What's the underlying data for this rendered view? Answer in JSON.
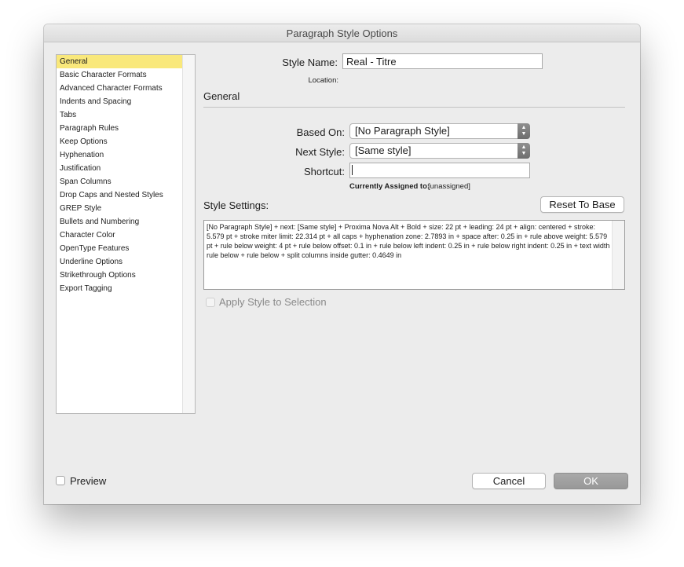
{
  "window": {
    "title": "Paragraph Style Options"
  },
  "sidebar": {
    "items": [
      {
        "label": "General",
        "selected": true
      },
      {
        "label": "Basic Character Formats"
      },
      {
        "label": "Advanced Character Formats"
      },
      {
        "label": "Indents and Spacing"
      },
      {
        "label": "Tabs"
      },
      {
        "label": "Paragraph Rules"
      },
      {
        "label": "Keep Options"
      },
      {
        "label": "Hyphenation"
      },
      {
        "label": "Justification"
      },
      {
        "label": "Span Columns"
      },
      {
        "label": "Drop Caps and Nested Styles"
      },
      {
        "label": "GREP Style"
      },
      {
        "label": "Bullets and Numbering"
      },
      {
        "label": "Character Color"
      },
      {
        "label": "OpenType Features"
      },
      {
        "label": "Underline Options"
      },
      {
        "label": "Strikethrough Options"
      },
      {
        "label": "Export Tagging"
      }
    ]
  },
  "form": {
    "style_name_label": "Style Name:",
    "style_name_value": "Real - Titre",
    "location_label": "Location:",
    "section_title": "General",
    "based_on_label": "Based On:",
    "based_on_value": "[No Paragraph Style]",
    "next_style_label": "Next Style:",
    "next_style_value": "[Same style]",
    "shortcut_label": "Shortcut:",
    "shortcut_value": "",
    "assigned_label": "Currently Assigned to:",
    "assigned_value": "[unassigned]",
    "style_settings_label": "Style Settings:",
    "reset_button": "Reset To Base",
    "style_settings_text": "[No Paragraph Style] + next: [Same style] + Proxima Nova Alt + Bold + size: 22 pt + leading: 24 pt + align: centered + stroke: 5.579 pt + stroke miter limit: 22.314 pt + all caps + hyphenation zone:  2.7893 in + space after: 0.25 in + rule above weight: 5.579 pt + rule below weight: 4 pt + rule below offset: 0.1 in + rule below left indent: 0.25 in + rule below right indent: 0.25 in + text width rule below + rule below + split columns inside gutter: 0.4649 in",
    "apply_label": "Apply Style to Selection",
    "apply_checked": false
  },
  "footer": {
    "preview_label": "Preview",
    "preview_checked": false,
    "cancel_button": "Cancel",
    "ok_button": "OK"
  },
  "colors": {
    "selection_highlight": "#f9e87b",
    "dialog_background": "#ececec"
  },
  "icons": {
    "popup_stepper": "up-down-chevron-icon"
  }
}
